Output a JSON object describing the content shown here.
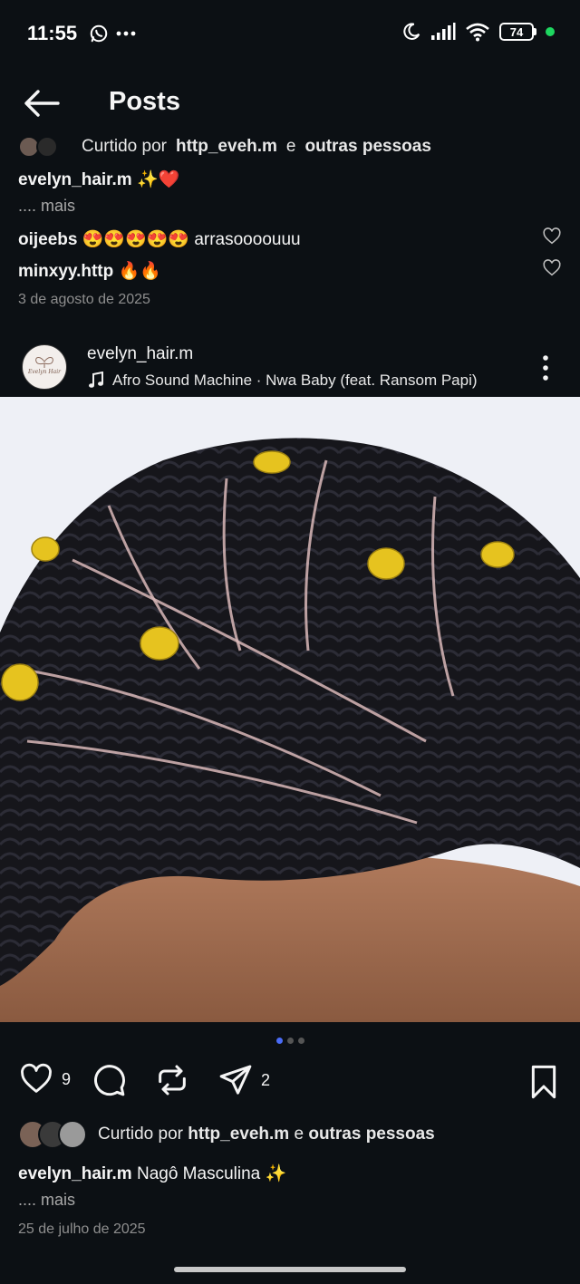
{
  "status_bar": {
    "time": "11:55",
    "battery": "74",
    "icons": [
      "whatsapp-icon",
      "more-dots-icon",
      "moon-icon",
      "signal-icon",
      "wifi-icon",
      "battery-icon"
    ]
  },
  "header": {
    "title": "Posts"
  },
  "previous_post": {
    "liked_prefix": "Curtido por",
    "liked_user": "http_eveh.m",
    "liked_conj": "e",
    "liked_suffix": "outras pessoas",
    "caption_user": "evelyn_hair.m",
    "caption_text": "✨❤️",
    "more": ".... mais",
    "comments": [
      {
        "user": "oijeebs",
        "text": "😍😍😍😍😍 arrasoooouuu"
      },
      {
        "user": "minxyy.http",
        "text": "🔥🔥"
      }
    ],
    "date": "3 de agosto de 2025"
  },
  "post": {
    "username": "evelyn_hair.m",
    "music": "Afro Sound Machine · Nwa Baby (feat. Ransom Papi)",
    "avatar_alt": "Evelyn Hair",
    "carousel": {
      "count": 3,
      "active_index": 0
    },
    "likes": "9",
    "shares": "2",
    "liked_prefix": "Curtido por",
    "liked_user": "http_eveh.m",
    "liked_conj": "e",
    "liked_suffix": "outras pessoas",
    "caption_user": "evelyn_hair.m",
    "caption_text": "Nagô Masculina ✨",
    "more": ".... mais",
    "date": "25 de julho de 2025"
  },
  "colors": {
    "background": "#0c1014",
    "text": "#f5f5f5",
    "muted": "#8e8e8e",
    "carousel_active": "#4a6cf7",
    "hair": "#15151a",
    "hair_bead": "#e6c31f",
    "skin": "#a06a4e"
  }
}
